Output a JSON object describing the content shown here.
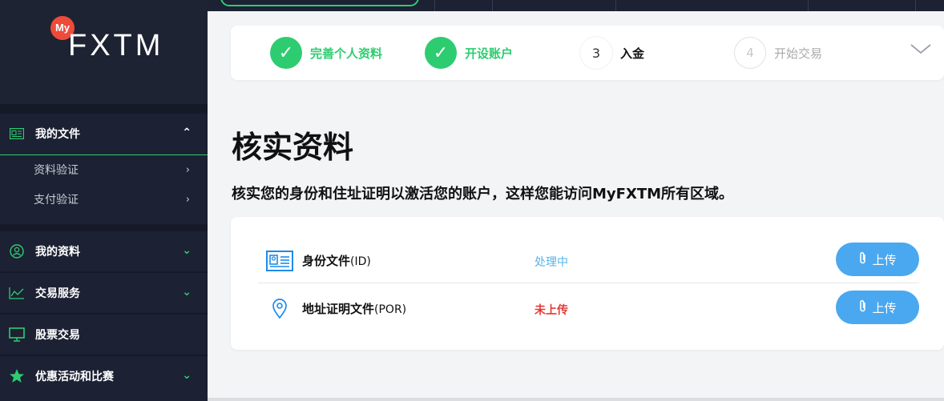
{
  "brand": {
    "badge": "My",
    "name": "FXTM",
    "badge_color": "#ee4b3a"
  },
  "colors": {
    "sidebar": "#1c2133",
    "accent_green": "#2ecc71",
    "accent_blue": "#4aa8f0",
    "status_processing": "#56b4e9",
    "status_missing": "#e53935"
  },
  "sidebar": {
    "my_docs": {
      "label": "我的文件",
      "icon": "id-card-icon",
      "expanded": true,
      "items": [
        {
          "label": "资料验证"
        },
        {
          "label": "支付验证"
        }
      ]
    },
    "groups": [
      {
        "label": "我的资料",
        "icon": "user-circle-icon"
      },
      {
        "label": "交易服务",
        "icon": "chart-line-icon"
      },
      {
        "label": "股票交易",
        "icon": "monitor-icon"
      },
      {
        "label": "优惠活动和比赛",
        "icon": "star-icon"
      }
    ]
  },
  "steps": [
    {
      "num": "",
      "label": "完善个人资料",
      "state": "done"
    },
    {
      "num": "",
      "label": "开设账户",
      "state": "done"
    },
    {
      "num": "3",
      "label": "入金",
      "state": "current"
    },
    {
      "num": "4",
      "label": "开始交易",
      "state": "pending"
    }
  ],
  "main": {
    "title": "核实资料",
    "subtitle": "核实您的身份和住址证明以激活您的账户，这样您能访问MyFXTM所有区域。",
    "documents": [
      {
        "name": "身份文件",
        "suffix": "(ID)",
        "status": "处理中",
        "button": "上传",
        "icon": "id-card-icon"
      },
      {
        "name": "地址证明文件",
        "suffix": "(POR)",
        "status": "未上传",
        "button": "上传",
        "icon": "location-pin-icon"
      }
    ]
  }
}
